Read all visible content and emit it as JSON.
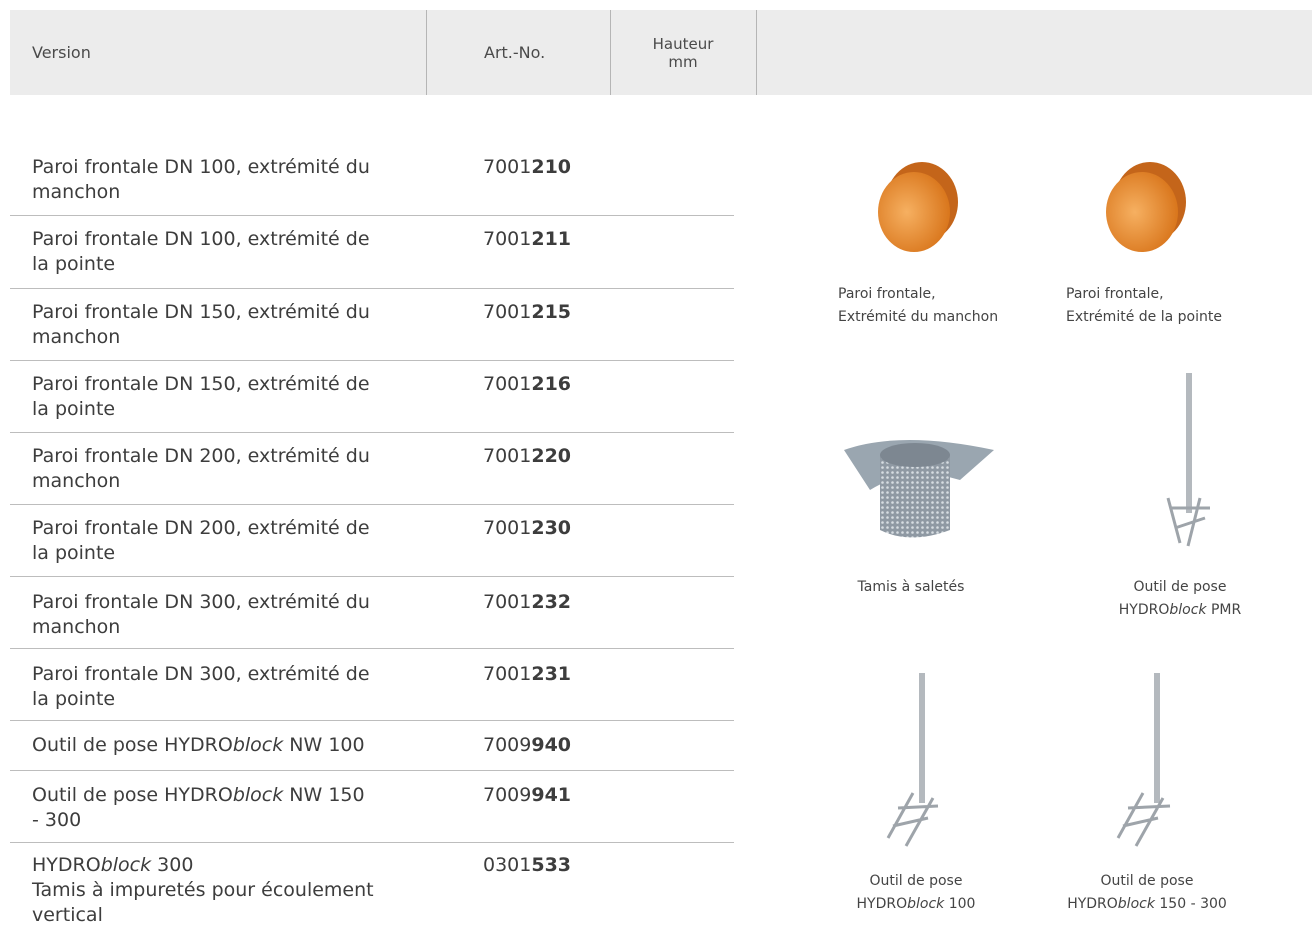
{
  "header": {
    "version": "Version",
    "art_no": "Art.-No.",
    "height_line1": "Hauteur",
    "height_line2": "mm"
  },
  "rows": [
    {
      "line1": "Paroi frontale DN 100, extrémité du",
      "line2": "manchon",
      "art_prefix": "7001",
      "art_bold": "210"
    },
    {
      "line1": "Paroi frontale DN 100, extrémité de",
      "line2": "la pointe",
      "art_prefix": "7001",
      "art_bold": "211"
    },
    {
      "line1": "Paroi frontale DN 150, extrémité du",
      "line2": "manchon",
      "art_prefix": "7001",
      "art_bold": "215"
    },
    {
      "line1": "Paroi frontale DN 150, extrémité de",
      "line2": "la pointe",
      "art_prefix": "7001",
      "art_bold": "216"
    },
    {
      "line1": "Paroi frontale DN 200, extrémité du",
      "line2": "manchon",
      "art_prefix": "7001",
      "art_bold": "220"
    },
    {
      "line1": "Paroi frontale DN 200, extrémité de",
      "line2": "la pointe",
      "art_prefix": "7001",
      "art_bold": "230"
    },
    {
      "line1": "Paroi frontale DN 300, extrémité du",
      "line2": "manchon",
      "art_prefix": "7001",
      "art_bold": "232"
    },
    {
      "line1": "Paroi frontale DN 300, extrémité de",
      "line2": "la pointe",
      "art_prefix": "7001",
      "art_bold": "231"
    },
    {
      "pre": "Outil de pose HYDRO",
      "ital": "block",
      "post": " NW 100",
      "art_prefix": "7009",
      "art_bold": "940"
    },
    {
      "pre": "Outil de pose HYDRO",
      "ital": "block",
      "post": " NW 150",
      "line2": "- 300",
      "art_prefix": "7009",
      "art_bold": "941"
    },
    {
      "pre": "HYDRO",
      "ital": "block",
      "post": " 300",
      "line2": "Tamis à impuretés pour écoulement",
      "line3": "vertical",
      "art_prefix": "0301",
      "art_bold": "533"
    }
  ],
  "captions": {
    "cap1_l1": "Paroi frontale,",
    "cap1_l2": "Extrémité du manchon",
    "cap2_l1": "Paroi frontale,",
    "cap2_l2": "Extrémité de la pointe",
    "cap3_l1": "Tamis à saletés",
    "cap4_l1": "Outil de pose",
    "cap4_pre": "HYDRO",
    "cap4_ital": "block",
    "cap4_post": " PMR",
    "cap5_l1": "Outil de pose",
    "cap5_pre": "HYDRO",
    "cap5_ital": "block",
    "cap5_post": " 100",
    "cap6_l1": "Outil de pose",
    "cap6_pre": "HYDRO",
    "cap6_ital": "block",
    "cap6_post": " 150 - 300"
  },
  "colors": {
    "header_bg": "#ececec",
    "cap_orange": "#e98b2a",
    "steel": "#a9afb5"
  }
}
